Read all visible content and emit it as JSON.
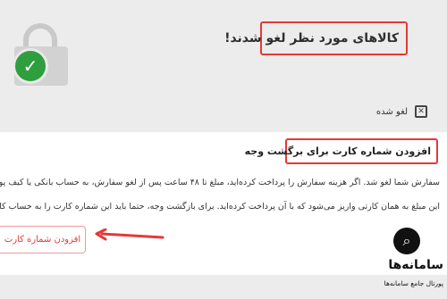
{
  "header": {
    "cancel_message": "کالاهای مورد نظر لغو شدند!",
    "lock_icon": "lock-icon",
    "check_icon": "check-icon"
  },
  "status": {
    "label": "لغو شده",
    "icon": "cancelled-box-icon"
  },
  "refund": {
    "title": "افزودن شماره کارت برای برگشت وجه",
    "line1": "سفارش شما لغو شد. اگر هزینه سفارش را پرداخت کرده‌اید، مبلغ تا ۴۸ ساعت پس از لغو سفارش، به حساب بانکی یا کیف پول ش",
    "line2": "این مبلغ به همان کارتی واریز می‌شود که با آن پرداخت کرده‌اید. برای بازگشت وجه، حتما باید این شماره کارت را به حساب کاربری",
    "button_label": "افزودن شماره کارت"
  },
  "brand": {
    "name": "سامانه‌ها",
    "tagline": "پورتال جامع سامانه‌ها"
  },
  "colors": {
    "highlight": "#e53935",
    "check_badge": "#2f9e3f"
  }
}
